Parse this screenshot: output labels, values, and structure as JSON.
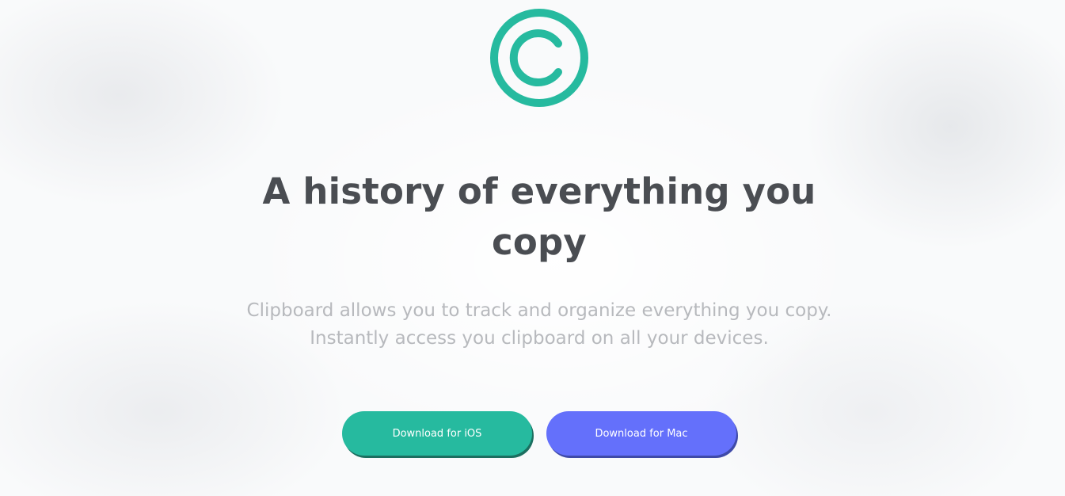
{
  "hero": {
    "title": "A history of everything you copy",
    "subtitle": "Clipboard allows you to track and organize everything you copy. Instantly access you clipboard on all your devices.",
    "ios_button_label": "Download for iOS",
    "mac_button_label": "Download for Mac"
  },
  "icons": {
    "logo": "clipboard-c-logo-icon"
  },
  "colors": {
    "accent_green": "#26ba9f",
    "accent_blue": "#6470fb",
    "title_text": "#4a4d52",
    "subtitle_text": "#b7b9bd"
  }
}
